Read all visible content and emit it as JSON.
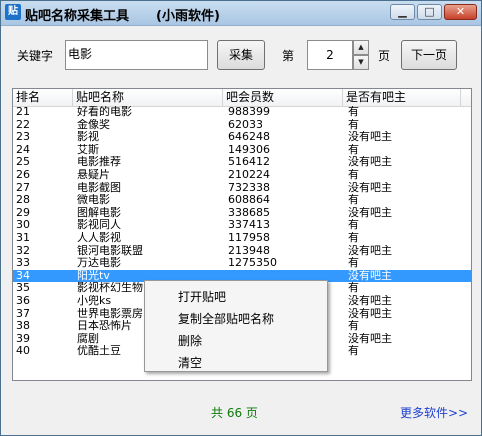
{
  "window": {
    "title": "贴吧名称采集工具",
    "subtitle": "(小雨软件)",
    "icon": "贴"
  },
  "controls": {
    "keyword_label": "关键字",
    "keyword_value": "电影",
    "collect_label": "采集",
    "page_prefix": "第",
    "page_value": "2",
    "page_suffix": "页",
    "next_label": "下一页"
  },
  "table": {
    "headers": [
      "排名",
      "贴吧名称",
      "吧会员数",
      "是否有吧主"
    ],
    "rows": [
      [
        "21",
        "好看的电影",
        "988399",
        "有"
      ],
      [
        "22",
        "金像奖",
        "62033",
        "有"
      ],
      [
        "23",
        "影视",
        "646248",
        "没有吧主"
      ],
      [
        "24",
        "艾斯",
        "149306",
        "有"
      ],
      [
        "25",
        "电影推荐",
        "516412",
        "没有吧主"
      ],
      [
        "26",
        "悬疑片",
        "210224",
        "有"
      ],
      [
        "27",
        "电影截图",
        "732338",
        "没有吧主"
      ],
      [
        "28",
        "微电影",
        "608864",
        "有"
      ],
      [
        "29",
        "图解电影",
        "338685",
        "没有吧主"
      ],
      [
        "30",
        "影视同人",
        "337413",
        "有"
      ],
      [
        "31",
        "人人影视",
        "117958",
        "有"
      ],
      [
        "32",
        "银河电影联盟",
        "213948",
        "没有吧主"
      ],
      [
        "33",
        "万达电影",
        "1275350",
        "有"
      ],
      [
        "34",
        "阳光tv",
        "",
        "没有吧主"
      ],
      [
        "35",
        "影视杯幻生物",
        "",
        "有"
      ],
      [
        "36",
        "小兜ks",
        "",
        "没有吧主"
      ],
      [
        "37",
        "世界电影票房",
        "",
        "没有吧主"
      ],
      [
        "38",
        "日本恐怖片",
        "",
        "有"
      ],
      [
        "39",
        "腐剧",
        "",
        "没有吧主"
      ],
      [
        "40",
        "优酷土豆",
        "",
        "有"
      ]
    ],
    "selected_index": 13
  },
  "context_menu": [
    "打开贴吧",
    "复制全部贴吧名称",
    "删除",
    "清空"
  ],
  "footer": {
    "count_text": "共 66 页",
    "more_link": "更多软件>>"
  },
  "colors": {
    "selection": "#3399ff",
    "count_green": "#0a7a0a",
    "link_blue": "#1d3fd0"
  }
}
